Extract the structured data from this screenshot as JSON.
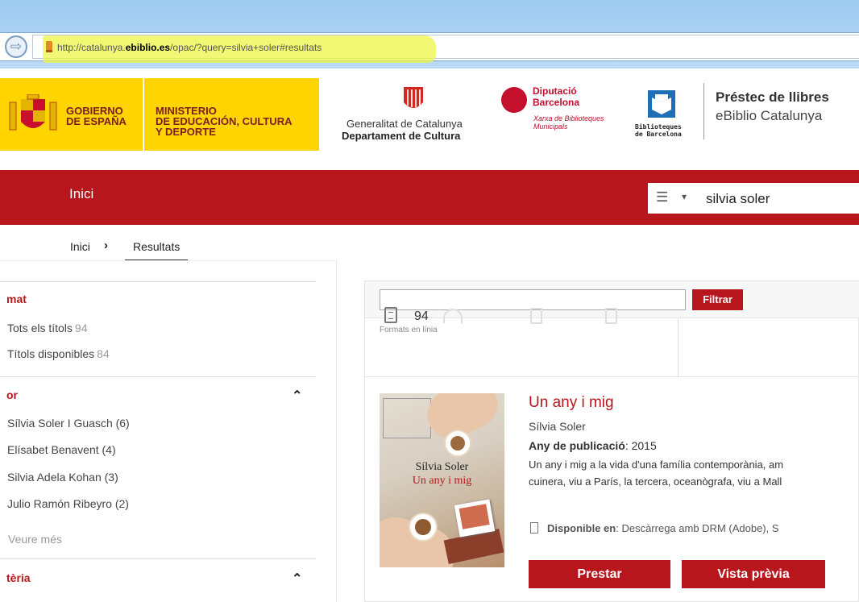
{
  "browser": {
    "url_prefix": "http://catalunya.",
    "url_domain": "ebiblio.es",
    "url_suffix": "/opac/?query=silvia+soler#resultats",
    "back_symbol": "⇨"
  },
  "logos": {
    "gobierno_line1": "GOBIERNO",
    "gobierno_line2": "DE ESPAÑA",
    "ministerio_line1": "MINISTERIO",
    "ministerio_line2": "DE EDUCACIÓN, CULTURA",
    "ministerio_line3": "Y DEPORTE",
    "gencat_line1": "Generalitat de Catalunya",
    "gencat_line2": "Departament de Cultura",
    "diputacio_line1": "Diputació",
    "diputacio_line2": "Barcelona",
    "diputacio_line3": "Xarxa de Biblioteques",
    "diputacio_line4": "Municipals",
    "biblioteques_line1": "Biblioteques",
    "biblioteques_line2": "de Barcelona",
    "prestec_line1": "Préstec de llibres",
    "prestec_line2": "eBiblio Catalunya"
  },
  "nav": {
    "home_label": "Inici",
    "search_mode_icon": "☰",
    "search_caret": "▾",
    "search_value": "silvia soler"
  },
  "breadcrumb": {
    "home": "Inici",
    "separator": "›",
    "current": "Resultats"
  },
  "sidebar": {
    "format": {
      "title": "mat",
      "items": [
        {
          "label": "Tots els títols",
          "count": "94"
        },
        {
          "label": "Títols disponibles",
          "count": "84"
        }
      ]
    },
    "author": {
      "title": "or",
      "chevron": "⌃",
      "items": [
        "Sílvia Soler I Guasch (6)",
        "Elísabet Benavent (4)",
        "Silvia Adela Kohan (3)",
        "Julio Ramón Ribeyro (2)"
      ],
      "more": "Veure més"
    },
    "subject": {
      "title": "tèria",
      "chevron": "⌃"
    }
  },
  "results": {
    "filter_button": "Filtrar",
    "filter_value": "",
    "formats_label": "Formats en línia",
    "ebook_count": "94"
  },
  "book": {
    "cover_author": "Sílvia Soler",
    "cover_title": "Un any i mig",
    "title": "Un any i mig",
    "author": "Sílvia Soler",
    "year_label": "Any de publicació",
    "year_value": ": 2015",
    "desc_line1": "Un any i mig a la vida d'una família contemporània, am",
    "desc_line2": "cuinera, viu a París, la tercera, oceanògrafa, viu a Mall",
    "avail_label": "Disponible en",
    "avail_value": ": Descàrrega amb DRM (Adobe), S",
    "borrow_button": "Prestar",
    "preview_button": "Vista prèvia"
  },
  "colors": {
    "brand_red": "#b7161d",
    "gobierno_yellow": "#ffd400",
    "url_highlight": "#ecf546"
  }
}
